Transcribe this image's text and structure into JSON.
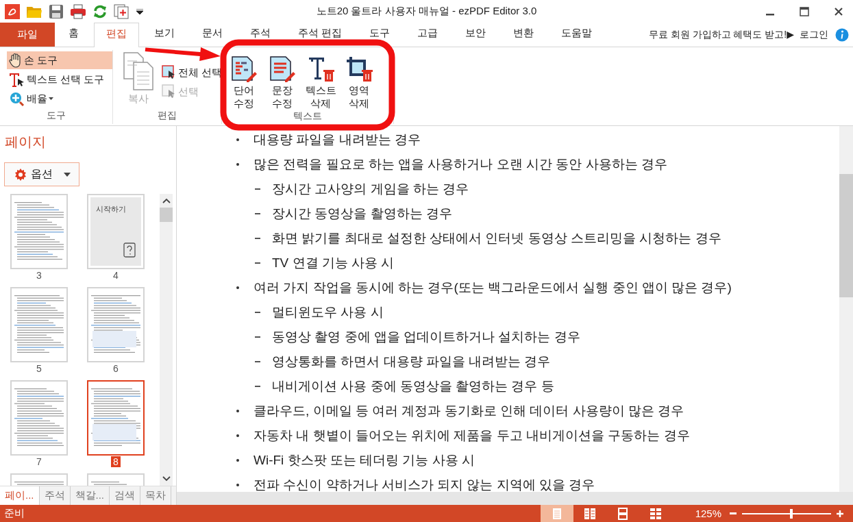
{
  "window": {
    "title": "노트20 울트라 사용자 매뉴얼 - ezPDF Editor 3.0"
  },
  "quick_access": [
    {
      "kind": "logo"
    },
    {
      "kind": "open"
    },
    {
      "kind": "save"
    },
    {
      "kind": "print"
    },
    {
      "kind": "refresh"
    },
    {
      "kind": "pages"
    },
    {
      "kind": "more"
    }
  ],
  "file_tab": {
    "label": "파일"
  },
  "tabs": [
    {
      "label": "홈",
      "selected": false
    },
    {
      "label": "편집",
      "selected": true
    },
    {
      "label": "보기",
      "selected": false
    },
    {
      "label": "문서",
      "selected": false
    },
    {
      "label": "주석",
      "selected": false
    },
    {
      "label": "주석 편집",
      "selected": false
    },
    {
      "label": "도구",
      "selected": false
    },
    {
      "label": "고급",
      "selected": false
    },
    {
      "label": "보안",
      "selected": false
    },
    {
      "label": "변환",
      "selected": false
    },
    {
      "label": "도움말",
      "selected": false
    }
  ],
  "promo": {
    "text": "무료 회원 가입하고 혜택도 받고!▶",
    "login": "로그인"
  },
  "ribbon": {
    "tools": {
      "label": "도구",
      "items": [
        {
          "kind": "hand",
          "label": "손 도구",
          "selected": true,
          "dropdown": false
        },
        {
          "kind": "text-select",
          "label": "텍스트 선택 도구",
          "selected": false,
          "dropdown": false
        },
        {
          "kind": "zoom",
          "label": "배율",
          "selected": false,
          "dropdown": true
        }
      ]
    },
    "edit": {
      "label": "편집",
      "copy": {
        "label": "복사",
        "disabled": true
      },
      "items": [
        {
          "kind": "select-all",
          "label": "전체 선택",
          "disabled": false
        },
        {
          "kind": "select-delete",
          "label": "선택",
          "disabled": true
        }
      ]
    },
    "text": {
      "label": "텍스트",
      "items": [
        {
          "kind": "word",
          "label": "단어 수정"
        },
        {
          "kind": "sentence",
          "label": "문장 수정"
        },
        {
          "kind": "text-delete",
          "label": "텍스트 삭제"
        },
        {
          "kind": "area-delete",
          "label": "영역 삭제"
        }
      ]
    }
  },
  "sidebar": {
    "title": "페이지",
    "options_button": "옵션",
    "cover_thumbnail_heading": "시작하기",
    "thumbnails": [
      {
        "kind": "text",
        "label": "3",
        "selected": false
      },
      {
        "kind": "cover",
        "label": "4",
        "selected": false
      },
      {
        "kind": "text",
        "label": "5",
        "selected": false
      },
      {
        "kind": "text",
        "label": "6",
        "selected": false
      },
      {
        "kind": "text",
        "label": "7",
        "selected": false
      },
      {
        "kind": "text",
        "label": "8",
        "selected": true
      },
      {
        "kind": "text",
        "selected": false
      },
      {
        "kind": "text",
        "selected": false
      }
    ],
    "tabs": [
      {
        "label": "페이...",
        "selected": true
      },
      {
        "label": "주석",
        "selected": false
      },
      {
        "label": "책갈...",
        "selected": false
      },
      {
        "label": "검색",
        "selected": false
      },
      {
        "label": "목차",
        "selected": false
      }
    ]
  },
  "document": {
    "lines": [
      {
        "kind": "bullet",
        "text": "대용량 파일을 내려받는 경우"
      },
      {
        "kind": "bullet",
        "text": "많은 전력을 필요로 하는 앱을 사용하거나 오랜 시간 동안 사용하는 경우"
      },
      {
        "kind": "dash",
        "text": "장시간 고사양의 게임을 하는 경우"
      },
      {
        "kind": "dash",
        "text": "장시간 동영상을 촬영하는 경우"
      },
      {
        "kind": "dash",
        "text": "화면 밝기를 최대로 설정한 상태에서 인터넷 동영상 스트리밍을 시청하는 경우"
      },
      {
        "kind": "dash",
        "text": "TV 연결 기능 사용 시"
      },
      {
        "kind": "bullet",
        "text": "여러 가지 작업을 동시에 하는 경우(또는 백그라운드에서 실행 중인 앱이 많은 경우)"
      },
      {
        "kind": "dash",
        "text": "멀티윈도우 사용 시"
      },
      {
        "kind": "dash",
        "text": "동영상 촬영 중에 앱을 업데이트하거나 설치하는 경우"
      },
      {
        "kind": "dash",
        "text": "영상통화를 하면서 대용량 파일을 내려받는 경우"
      },
      {
        "kind": "dash",
        "text": "내비게이션 사용 중에 동영상을 촬영하는 경우 등"
      },
      {
        "kind": "bullet",
        "text": "클라우드, 이메일 등 여러 계정과 동기화로 인해 데이터 사용량이 많은 경우"
      },
      {
        "kind": "bullet",
        "text": "자동차 내 햇볕이 들어오는 위치에 제품을 두고 내비게이션을 구동하는 경우"
      },
      {
        "kind": "bullet",
        "text": "Wi-Fi 핫스팟 또는 테더링 기능 사용 시"
      },
      {
        "kind": "bullet",
        "text": "전파 수신이 약하거나 서비스가 되지 않는 지역에 있을 경우"
      }
    ]
  },
  "status_bar": {
    "text": "준비",
    "views": [
      {
        "kind": "single",
        "selected": true
      },
      {
        "kind": "double",
        "selected": false
      },
      {
        "kind": "continuous",
        "selected": false
      },
      {
        "kind": "grid",
        "selected": false
      }
    ],
    "zoom": "125%",
    "zoom_slider": {
      "level": 0.54
    }
  }
}
